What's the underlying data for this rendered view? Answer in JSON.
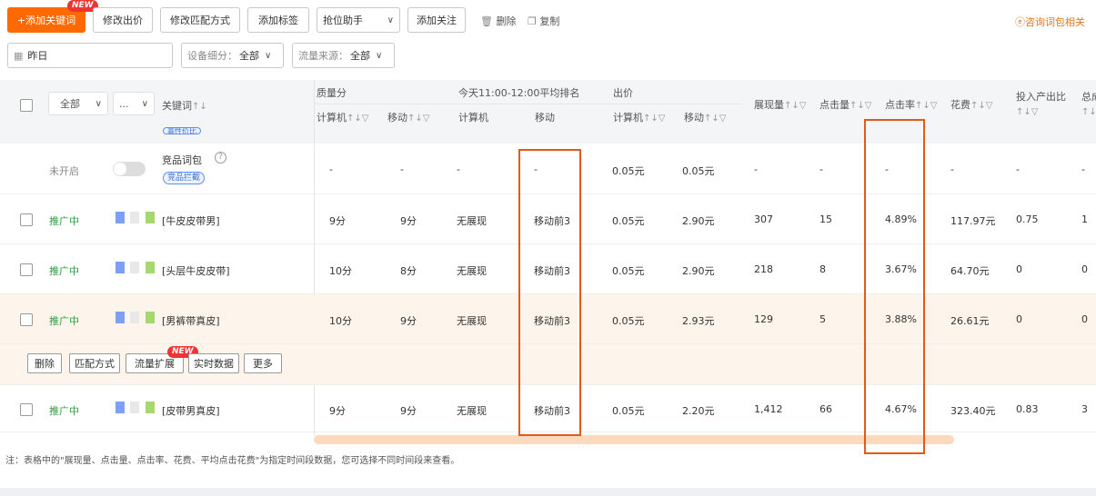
{
  "toolbar": {
    "add_keyword": "+添加关键词",
    "new_badge": "NEW",
    "modify_bid": "修改出价",
    "modify_match": "修改匹配方式",
    "add_tag": "添加标签",
    "rank_helper": "抢位助手",
    "add_follow": "添加关注",
    "delete": "删除",
    "copy": "复制",
    "consult": "咨询词包相关"
  },
  "filters": {
    "date": "昨日",
    "device_label": "设备细分：",
    "device_value": "全部",
    "source_label": "流量来源：",
    "source_value": "全部"
  },
  "table": {
    "header": {
      "all_select": "全部",
      "more_select": "...",
      "keyword": "关键词",
      "quality": "质量分",
      "rank_group": "今天11:00-12:00平均排名",
      "bid": "出价",
      "pc": "计算机",
      "mobile": "移动",
      "impressions": "展现量",
      "clicks": "点击量",
      "ctr": "点击率",
      "cost": "花费",
      "roi": "投入产出比",
      "total": "总成"
    },
    "partial_tag": "高性价比",
    "rows": [
      {
        "status": "未开启",
        "keyword": "竞品词包",
        "tag": "竞品拦截",
        "q_pc": "-",
        "q_mobile": "-",
        "r_pc": "-",
        "r_mobile": "-",
        "bid_pc": "0.05元",
        "bid_mobile": "0.05元",
        "impressions": "-",
        "clicks": "-",
        "ctr": "-",
        "cost": "-",
        "roi": "-",
        "total": "-"
      },
      {
        "status": "推广中",
        "keyword": "[牛皮皮带男]",
        "q_pc": "9分",
        "q_mobile": "9分",
        "r_pc": "无展现",
        "r_mobile": "移动前3",
        "bid_pc": "0.05元",
        "bid_mobile": "2.90元",
        "impressions": "307",
        "clicks": "15",
        "ctr": "4.89%",
        "cost": "117.97元",
        "roi": "0.75",
        "total": "1"
      },
      {
        "status": "推广中",
        "keyword": "[头层牛皮皮带]",
        "q_pc": "10分",
        "q_mobile": "8分",
        "r_pc": "无展现",
        "r_mobile": "移动前3",
        "bid_pc": "0.05元",
        "bid_mobile": "2.90元",
        "impressions": "218",
        "clicks": "8",
        "ctr": "3.67%",
        "cost": "64.70元",
        "roi": "0",
        "total": "0"
      },
      {
        "status": "推广中",
        "keyword": "[男裤带真皮]",
        "q_pc": "10分",
        "q_mobile": "9分",
        "r_pc": "无展现",
        "r_mobile": "移动前3",
        "bid_pc": "0.05元",
        "bid_mobile": "2.93元",
        "impressions": "129",
        "clicks": "5",
        "ctr": "3.88%",
        "cost": "26.61元",
        "roi": "0",
        "total": "0"
      },
      {
        "status": "推广中",
        "keyword": "[皮带男真皮]",
        "q_pc": "9分",
        "q_mobile": "9分",
        "r_pc": "无展现",
        "r_mobile": "移动前3",
        "bid_pc": "0.05元",
        "bid_mobile": "2.20元",
        "impressions": "1,412",
        "clicks": "66",
        "ctr": "4.67%",
        "cost": "323.40元",
        "roi": "0.83",
        "total": "3"
      }
    ],
    "row_actions": {
      "delete": "删除",
      "match": "匹配方式",
      "traffic": "流量扩展",
      "realtime": "实时数据",
      "more": "更多",
      "new_badge": "NEW"
    }
  },
  "footnote": "注：表格中的\"展现量、点击量、点击率、花费、平均点击花费\"为指定时间段数据，您可选择不同时间段来查看。",
  "colors": {
    "primary": "#ff6a00",
    "highlight": "#e05a1a",
    "status_on": "#2a9d3a"
  }
}
